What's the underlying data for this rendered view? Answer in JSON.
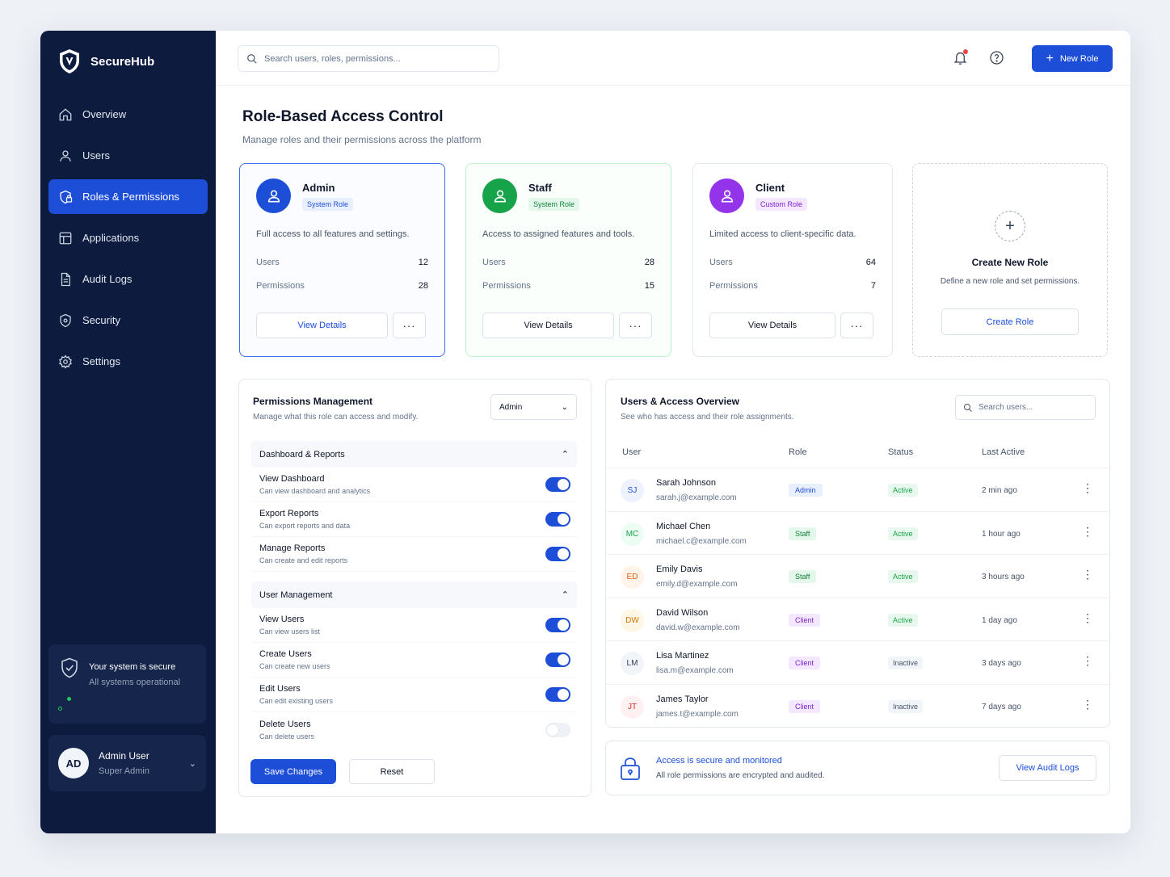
{
  "app": {
    "name": "SecureHub"
  },
  "sidebar": {
    "items": [
      {
        "label": "Overview",
        "icon": "home-icon"
      },
      {
        "label": "Users",
        "icon": "user-icon"
      },
      {
        "label": "Roles & Permissions",
        "icon": "shield-lock-icon",
        "active": true
      },
      {
        "label": "Applications",
        "icon": "grid-icon"
      },
      {
        "label": "Audit Logs",
        "icon": "document-icon"
      },
      {
        "label": "Security",
        "icon": "shield-icon"
      },
      {
        "label": "Settings",
        "icon": "gear-icon"
      }
    ],
    "status": {
      "title": "Your system is secure",
      "subtitle": "All systems operational"
    },
    "user": {
      "initials": "AD",
      "name": "Admin User",
      "role": "Super Admin"
    }
  },
  "topbar": {
    "search_placeholder": "Search users, roles, permissions...",
    "new_role_label": "New Role"
  },
  "page": {
    "title": "Role-Based Access Control",
    "subtitle": "Manage roles and their permissions across the platform"
  },
  "roles": [
    {
      "name": "Admin",
      "tag": "System Role",
      "desc": "Full access to all features and settings.",
      "users_label": "Users",
      "users": "12",
      "perms_label": "Permissions",
      "perms": "28",
      "view_label": "View Details",
      "more_label": "···",
      "color": "#1d4ed8"
    },
    {
      "name": "Staff",
      "tag": "System Role",
      "desc": "Access to assigned features and tools.",
      "users_label": "Users",
      "users": "28",
      "perms_label": "Permissions",
      "perms": "15",
      "view_label": "View Details",
      "more_label": "···",
      "color": "#16a34a"
    },
    {
      "name": "Client",
      "tag": "Custom Role",
      "desc": "Limited access to client-specific data.",
      "users_label": "Users",
      "users": "64",
      "perms_label": "Permissions",
      "perms": "7",
      "view_label": "View Details",
      "more_label": "···",
      "color": "#9333ea"
    }
  ],
  "create_role": {
    "plus": "+",
    "title": "Create New Role",
    "desc": "Define a new role and set permissions.",
    "button": "Create Role"
  },
  "permissions": {
    "title": "Permissions Management",
    "subtitle": "Manage what this role can access and modify.",
    "selected_role": "Admin",
    "groups": [
      {
        "name": "Dashboard & Reports",
        "items": [
          {
            "name": "View Dashboard",
            "desc": "Can view dashboard and analytics",
            "on": true
          },
          {
            "name": "Export Reports",
            "desc": "Can export reports and data",
            "on": true
          },
          {
            "name": "Manage Reports",
            "desc": "Can create and edit reports",
            "on": true
          }
        ]
      },
      {
        "name": "User Management",
        "items": [
          {
            "name": "View Users",
            "desc": "Can view users list",
            "on": true
          },
          {
            "name": "Create Users",
            "desc": "Can create new users",
            "on": true
          },
          {
            "name": "Edit Users",
            "desc": "Can edit existing users",
            "on": true
          },
          {
            "name": "Delete Users",
            "desc": "Can delete users",
            "on": false
          }
        ]
      }
    ],
    "save_label": "Save Changes",
    "reset_label": "Reset"
  },
  "users_overview": {
    "title": "Users & Access Overview",
    "subtitle": "See who has access and their role assignments.",
    "search_placeholder": "Search users...",
    "columns": [
      "User",
      "Role",
      "Status",
      "Last Active"
    ],
    "rows": [
      {
        "initials": "SJ",
        "name": "Sarah Johnson",
        "email": "sarah.j@example.com",
        "role": "Admin",
        "status": "Active",
        "last": "2 min ago"
      },
      {
        "initials": "MC",
        "name": "Michael Chen",
        "email": "michael.c@example.com",
        "role": "Staff",
        "status": "Active",
        "last": "1 hour ago"
      },
      {
        "initials": "ED",
        "name": "Emily Davis",
        "email": "emily.d@example.com",
        "role": "Staff",
        "status": "Active",
        "last": "3 hours ago"
      },
      {
        "initials": "DW",
        "name": "David Wilson",
        "email": "david.w@example.com",
        "role": "Client",
        "status": "Active",
        "last": "1 day ago"
      },
      {
        "initials": "LM",
        "name": "Lisa Martinez",
        "email": "lisa.m@example.com",
        "role": "Client",
        "status": "Inactive",
        "last": "3 days ago"
      },
      {
        "initials": "JT",
        "name": "James Taylor",
        "email": "james.t@example.com",
        "role": "Client",
        "status": "Inactive",
        "last": "7 days ago"
      }
    ]
  },
  "info": {
    "title": "Access is secure and monitored",
    "subtitle": "All role permissions are encrypted and audited.",
    "button": "View Audit Logs"
  }
}
